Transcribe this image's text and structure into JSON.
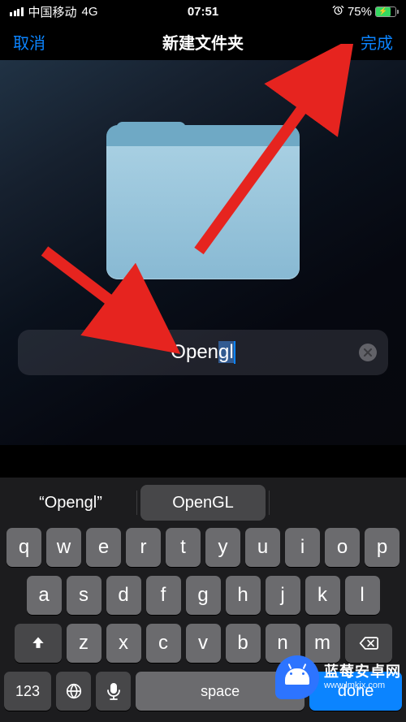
{
  "status": {
    "carrier": "中国移动",
    "network": "4G",
    "time": "07:51",
    "battery_pct": "75%",
    "battery_fill_pct": 75,
    "alarm_icon": "alarm-icon"
  },
  "nav": {
    "cancel": "取消",
    "title": "新建文件夹",
    "done": "完成"
  },
  "folder": {
    "input_value": "Opengl",
    "input_unselected": "Open",
    "input_selected": "gl"
  },
  "keyboard": {
    "suggestions": [
      "“Opengl”",
      "OpenGL"
    ],
    "row1": [
      "q",
      "w",
      "e",
      "r",
      "t",
      "y",
      "u",
      "i",
      "o",
      "p"
    ],
    "row2": [
      "a",
      "s",
      "d",
      "f",
      "g",
      "h",
      "j",
      "k",
      "l"
    ],
    "row3": [
      "z",
      "x",
      "c",
      "v",
      "b",
      "n",
      "m"
    ],
    "shift": "⇧",
    "backspace": "⌫",
    "numbers": "123",
    "globe": "globe-icon",
    "mic": "mic-icon",
    "space": "space",
    "return": "done"
  },
  "watermark": {
    "title": "蓝莓安卓网",
    "url": "www.lmkjx.com"
  },
  "colors": {
    "accent": "#0b84ff",
    "arrow": "#e6241f"
  }
}
